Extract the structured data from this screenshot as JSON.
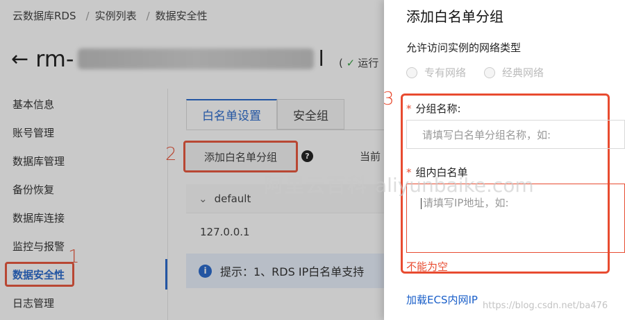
{
  "breadcrumb": {
    "items": [
      "云数据库RDS",
      "实例列表",
      "数据安全性"
    ],
    "separator": "/"
  },
  "instance": {
    "prefix": "rm-",
    "suffix": "l"
  },
  "status": {
    "label": "运行"
  },
  "sidebar": {
    "items": [
      {
        "label": "基本信息"
      },
      {
        "label": "账号管理"
      },
      {
        "label": "数据库管理"
      },
      {
        "label": "备份恢复"
      },
      {
        "label": "数据库连接"
      },
      {
        "label": "监控与报警"
      },
      {
        "label": "数据安全性",
        "active": true
      },
      {
        "label": "日志管理"
      }
    ]
  },
  "tabs": [
    {
      "label": "白名单设置",
      "active": true
    },
    {
      "label": "安全组"
    }
  ],
  "toolbar": {
    "add_group_label": "添加白名单分组",
    "current_label": "当前"
  },
  "whitelist": {
    "group_name": "default",
    "ip": "127.0.0.1"
  },
  "tip": {
    "text": "提示：1、RDS IP白名单支持"
  },
  "step_numbers": {
    "one": "1",
    "two": "2",
    "three": "3"
  },
  "drawer": {
    "title": "添加白名单分组",
    "network_label": "允许访问实例的网络类型",
    "network_options": [
      "专有网络",
      "经典网络"
    ],
    "group_name_label": "分组名称:",
    "group_name_placeholder": "请填写白名单分组名称，如:",
    "whitelist_label": "组内白名单",
    "whitelist_placeholder": "请填写IP地址，如:",
    "error_text": "不能为空",
    "load_ecs_link": "加载ECS内网IP"
  },
  "watermark": {
    "text": "阿里云百科",
    "latin": "aliyunbaike.com",
    "url": "https://blog.csdn.net/ba476"
  },
  "colors": {
    "accent": "#1a5fc9",
    "highlight": "#e84b30"
  }
}
